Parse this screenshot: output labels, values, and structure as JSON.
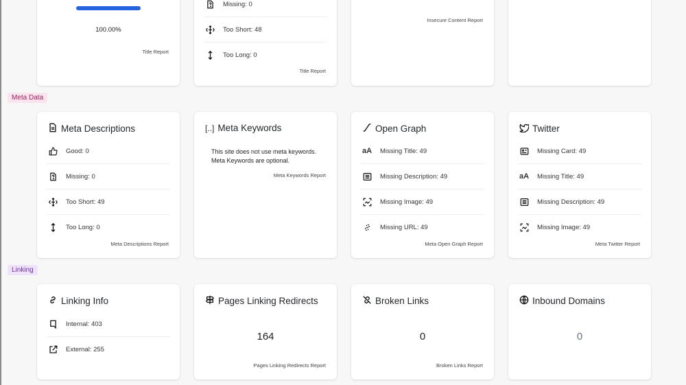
{
  "top_row": {
    "title_card": {
      "progress_percent": 100,
      "percent_text": "100.00%",
      "report_link": "Title Report"
    },
    "title_issues_card": {
      "rows": [
        {
          "icon": "file-question-icon",
          "text": "Missing: 0"
        },
        {
          "icon": "compress-arrows-icon",
          "text": "Too Short: 48"
        },
        {
          "icon": "arrows-vertical-icon",
          "text": "Too Long: 0"
        }
      ],
      "report_link": "Title Report"
    },
    "insecure_card": {
      "report_link": "Insecure Content Report"
    }
  },
  "sections": {
    "meta_data": {
      "label": "Meta Data",
      "color_bg": "#fce4ef",
      "color_text": "#a21e5c"
    },
    "linking": {
      "label": "Linking",
      "color_bg": "#efe3fb",
      "color_text": "#6b2fa6"
    }
  },
  "meta_descriptions": {
    "title": "Meta Descriptions",
    "icon": "document-icon",
    "rows": [
      {
        "icon": "thumbs-up-icon",
        "text": "Good: 0"
      },
      {
        "icon": "file-question-icon",
        "text": "Missing: 0"
      },
      {
        "icon": "compress-arrows-icon",
        "text": "Too Short: 49"
      },
      {
        "icon": "arrows-vertical-icon",
        "text": "Too Long: 0"
      }
    ],
    "report_link": "Meta Descriptions Report"
  },
  "meta_keywords": {
    "title": "Meta Keywords",
    "icon": "brackets-icon",
    "icon_text": "[..]",
    "line1": "This site does not use meta keywords.",
    "line2": "Meta Keywords are optional.",
    "report_link": "Meta Keywords Report"
  },
  "open_graph": {
    "title": "Open Graph",
    "icon": "curve-icon",
    "rows": [
      {
        "icon": "font-size-icon",
        "text": "Missing Title: 49"
      },
      {
        "icon": "text-box-icon",
        "text": "Missing Description: 49"
      },
      {
        "icon": "image-scan-icon",
        "text": "Missing Image: 49"
      },
      {
        "icon": "link-dashed-icon",
        "text": "Missing URL: 49"
      }
    ],
    "report_link": "Meta Open Graph Report"
  },
  "twitter": {
    "title": "Twitter",
    "icon": "twitter-bird-icon",
    "rows": [
      {
        "icon": "id-card-icon",
        "text": "Missing Card: 49"
      },
      {
        "icon": "font-size-icon",
        "text": "Missing Title: 49"
      },
      {
        "icon": "text-box-icon",
        "text": "Missing Description: 49"
      },
      {
        "icon": "image-scan-icon",
        "text": "Missing Image: 49"
      }
    ],
    "report_link": "Meta Twitter Report"
  },
  "linking_info": {
    "title": "Linking Info",
    "icon": "link-icon",
    "rows": [
      {
        "icon": "bookmark-icon",
        "text": "Internal: 403"
      },
      {
        "icon": "external-link-icon",
        "text": "External: 255"
      }
    ]
  },
  "pages_linking_redirects": {
    "title": "Pages Linking Redirects",
    "icon": "signpost-icon",
    "value": "164",
    "report_link": "Pages Linking Redirects Report"
  },
  "broken_links": {
    "title": "Broken Links",
    "icon": "broken-link-icon",
    "value": "0",
    "report_link": "Broken Links Report"
  },
  "inbound_domains": {
    "title": "Inbound Domains",
    "icon": "globe-www-icon",
    "value": "0"
  }
}
